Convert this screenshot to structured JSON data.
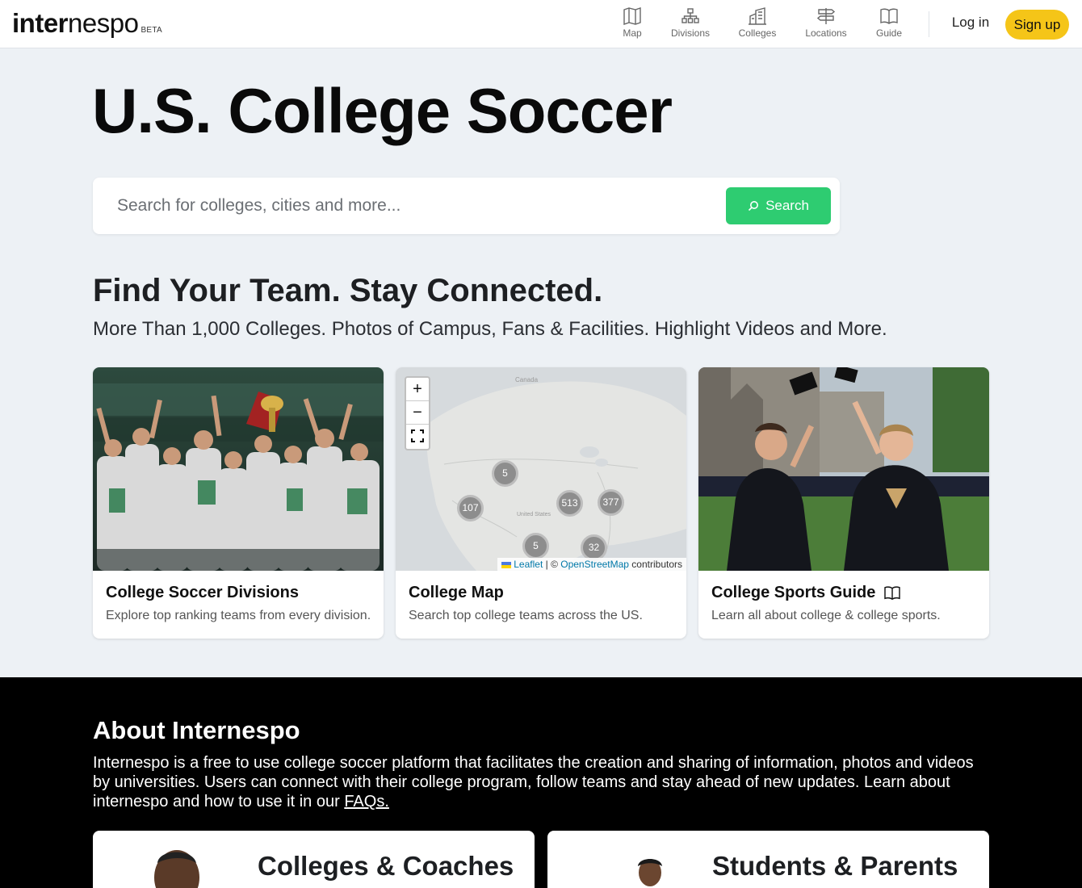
{
  "header": {
    "logo_bold": "inter",
    "logo_light": "nespo",
    "logo_badge": "BETA",
    "nav": [
      {
        "label": "Map",
        "icon": "map-icon"
      },
      {
        "label": "Divisions",
        "icon": "divisions-icon"
      },
      {
        "label": "Colleges",
        "icon": "colleges-icon"
      },
      {
        "label": "Locations",
        "icon": "signpost-icon"
      },
      {
        "label": "Guide",
        "icon": "book-icon"
      }
    ],
    "login": "Log in",
    "signup": "Sign up"
  },
  "hero": {
    "title": "U.S. College Soccer",
    "search_placeholder": "Search for colleges, cities and more...",
    "search_button": "Search"
  },
  "intro": {
    "tagline": "Find Your Team. Stay Connected.",
    "subline": "More Than 1,000 Colleges. Photos of Campus, Fans & Facilities. Highlight Videos and More."
  },
  "cards": [
    {
      "title": "College Soccer Divisions",
      "desc": "Explore top ranking teams from every division."
    },
    {
      "title": "College Map",
      "desc": "Search top college teams across the US."
    },
    {
      "title": "College Sports Guide",
      "desc": "Learn all about college & college sports."
    }
  ],
  "map": {
    "zoom_in": "+",
    "zoom_out": "−",
    "label_canada": "Canada",
    "label_us": "United States",
    "clusters": [
      "5",
      "107",
      "513",
      "377",
      "5",
      "32"
    ],
    "attribution_leaflet": "Leaflet",
    "attribution_sep": " | © ",
    "attribution_osm": "OpenStreetMap",
    "attribution_tail": " contributors"
  },
  "about": {
    "title": "About Internespo",
    "text": "Internespo is a free to use college soccer platform that facilitates the creation and sharing of information, photos and videos by universities. Users can connect with their college program, follow teams and stay ahead of new updates. Learn about internespo and how to use it in our ",
    "faq_link": "FAQs.",
    "cards": [
      {
        "title": "Colleges & Coaches"
      },
      {
        "title": "Students & Parents"
      }
    ]
  },
  "colors": {
    "accent_green": "#2ecc71",
    "signup_yellow": "#f5c518",
    "page_bg": "#edf1f5"
  }
}
